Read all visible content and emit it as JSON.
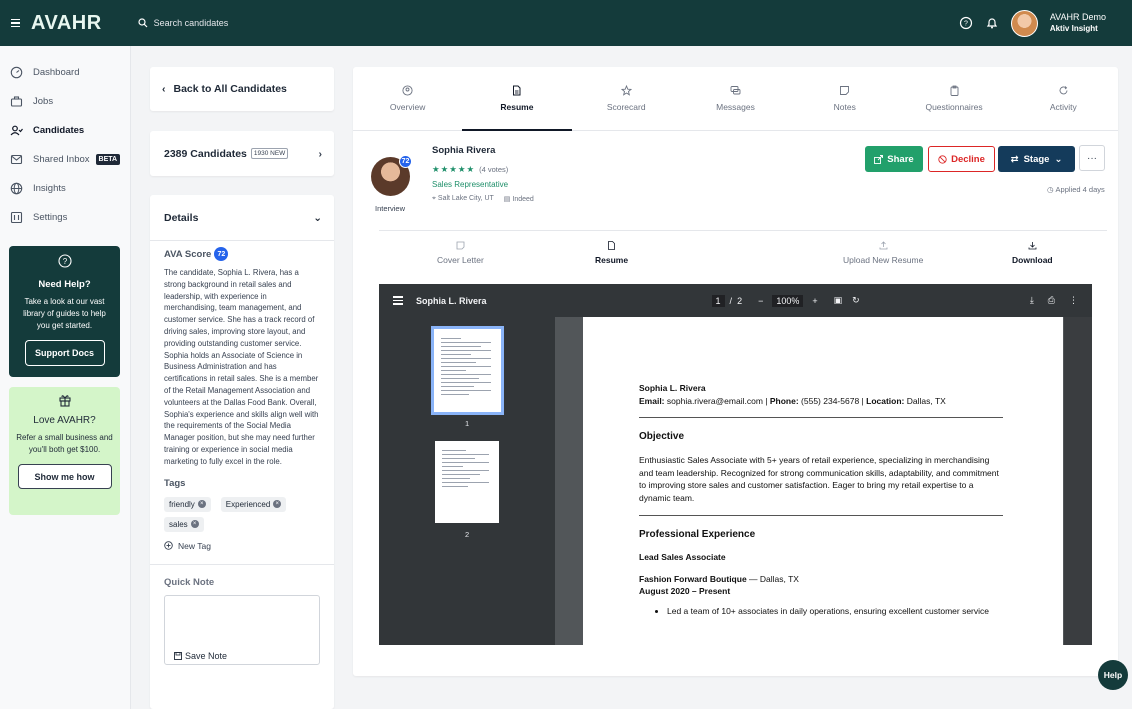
{
  "topbar": {
    "logo": "AVAHR",
    "search_placeholder": "Search candidates",
    "user_name": "AVAHR Demo",
    "user_org": "Aktiv Insight"
  },
  "sidebar": {
    "items": [
      {
        "label": "Dashboard",
        "icon": "gauge-icon"
      },
      {
        "label": "Jobs",
        "icon": "briefcase-icon"
      },
      {
        "label": "Candidates",
        "icon": "candidates-icon"
      },
      {
        "label": "Shared Inbox",
        "icon": "inbox-icon",
        "badge": "BETA"
      },
      {
        "label": "Insights",
        "icon": "globe-icon"
      },
      {
        "label": "Settings",
        "icon": "settings-icon"
      }
    ],
    "help": {
      "title": "Need Help?",
      "text": "Take a look at our vast library of guides to help you get started.",
      "button": "Support Docs"
    },
    "love": {
      "title": "Love AVAHR?",
      "text": "Refer a small business and you'll both get $100.",
      "button": "Show me how"
    }
  },
  "left": {
    "back_label": "Back to All Candidates",
    "candidate_count": "2389 Candidates",
    "new_badge": "1930 NEW",
    "details_title": "Details",
    "ava_score_label": "AVA Score",
    "ava_score": "72",
    "ava_summary": "The candidate, Sophia L. Rivera, has a strong background in retail sales and leadership, with experience in merchandising, team management, and customer service. She has a track record of driving sales, improving store layout, and providing outstanding customer service. Sophia holds an Associate of Science in Business Administration and has certifications in retail sales. She is a member of the Retail Management Association and volunteers at the Dallas Food Bank. Overall, Sophia's experience and skills align well with the requirements of the Social Media Manager position, but she may need further training or experience in social media marketing to fully excel in the role.",
    "tags_title": "Tags",
    "tags": [
      "friendly",
      "Experienced",
      "sales"
    ],
    "new_tag": "New Tag",
    "quick_note_title": "Quick Note",
    "save_note": "Save Note"
  },
  "tabs": [
    {
      "label": "Overview",
      "icon": "person-circle-icon"
    },
    {
      "label": "Resume",
      "icon": "document-icon",
      "active": true
    },
    {
      "label": "Scorecard",
      "icon": "star-icon"
    },
    {
      "label": "Messages",
      "icon": "chat-icon"
    },
    {
      "label": "Notes",
      "icon": "note-icon"
    },
    {
      "label": "Questionnaires",
      "icon": "clipboard-icon"
    },
    {
      "label": "Activity",
      "icon": "refresh-icon"
    }
  ],
  "candidate": {
    "name": "Sophia Rivera",
    "score": "72",
    "status": "Interview",
    "stars": "★★★★★",
    "votes": "(4 votes)",
    "role": "Sales Representative",
    "location": "Salt Lake City, UT",
    "source": "Indeed",
    "applied": "Applied 4 days"
  },
  "actions": {
    "share": "Share",
    "decline": "Decline",
    "stage": "Stage",
    "more": "···"
  },
  "subtabs": {
    "cover_letter": "Cover Letter",
    "resume": "Resume",
    "upload": "Upload New Resume",
    "download": "Download"
  },
  "pdf": {
    "title": "Sophia L. Rivera",
    "page_current": "1",
    "page_sep": "/",
    "page_total": "2",
    "zoom": "100%",
    "thumb1": "1",
    "thumb2": "2",
    "resume_name": "Sophia L. Rivera",
    "email_label": "Email:",
    "email": "sophia.rivera@email.com",
    "phone_label": "Phone:",
    "phone": "(555) 234-5678",
    "location_label": "Location:",
    "location": "Dallas, TX",
    "objective_title": "Objective",
    "objective": "Enthusiastic Sales Associate with 5+ years of retail experience, specializing in merchandising and team leadership. Recognized for strong communication skills, adaptability, and commitment to improving store sales and customer satisfaction. Eager to bring my retail expertise to a dynamic team.",
    "experience_title": "Professional Experience",
    "job_title": "Lead Sales Associate",
    "company": "Fashion Forward Boutique",
    "company_location": "— Dallas, TX",
    "dates": "August 2020 – Present",
    "bullet1": "Led a team of 10+ associates in daily operations, ensuring excellent customer service"
  },
  "help_fab": "Help"
}
